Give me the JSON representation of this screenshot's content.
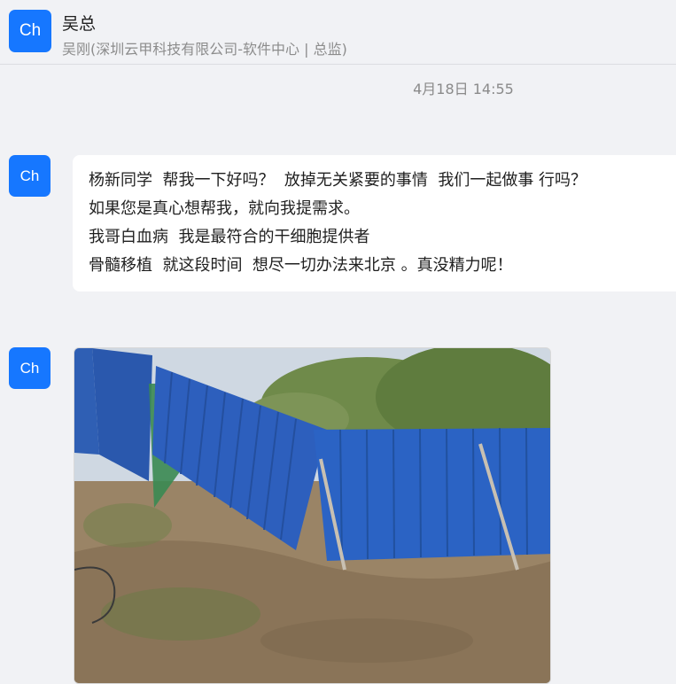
{
  "header": {
    "avatar_text": "Ch",
    "contact_name": "吴总",
    "contact_subtitle": "吴刚(深圳云甲科技有限公司-软件中心 | 总监)"
  },
  "messages": [
    {
      "timestamp": "4月18日 14:55",
      "avatar_text": "Ch",
      "lines": [
        "杨新同学  帮我一下好吗？  放掉无关紧要的事情  我们一起做事 行吗？",
        "如果您是真心想帮我，就向我提需求。",
        "我哥白血病  我是最符合的干细胞提供者",
        "骨髓移植  就这段时间  想尽一切办法来北京 。真没精力呢！"
      ]
    },
    {
      "avatar_text": "Ch",
      "image": "photo-blue-fence"
    }
  ],
  "colors": {
    "accent": "#1677ff",
    "background": "#f1f2f5",
    "bubble": "#ffffff"
  }
}
